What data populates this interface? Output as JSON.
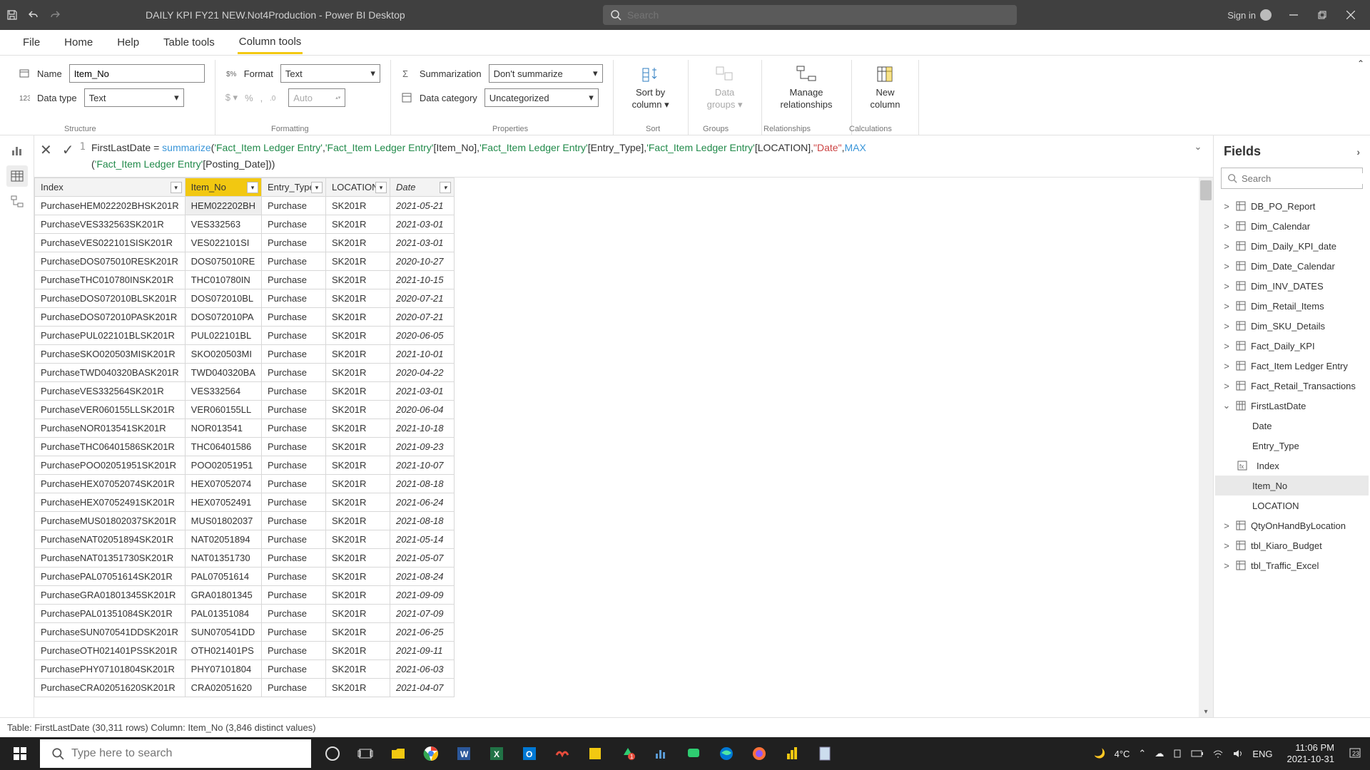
{
  "title": "DAILY KPI FY21 NEW.Not4Production - Power BI Desktop",
  "search_placeholder": "Search",
  "signin": "Sign in",
  "tabs": {
    "file": "File",
    "home": "Home",
    "help": "Help",
    "table_tools": "Table tools",
    "column_tools": "Column tools"
  },
  "ribbon": {
    "name_label": "Name",
    "name_value": "Item_No",
    "datatype_label": "Data type",
    "datatype_value": "Text",
    "format_label": "Format",
    "format_value": "Text",
    "auto_value": "Auto",
    "summarization_label": "Summarization",
    "summarization_value": "Don't summarize",
    "datacategory_label": "Data category",
    "datacategory_value": "Uncategorized",
    "sort_by": "Sort by",
    "column": "column",
    "data": "Data",
    "groups": "groups",
    "manage": "Manage",
    "relationships": "relationships",
    "new": "New",
    "calc_column": "column",
    "group_labels": {
      "structure": "Structure",
      "formatting": "Formatting",
      "properties": "Properties",
      "sort": "Sort",
      "groups_g": "Groups",
      "relationships_g": "Relationships",
      "calculations": "Calculations"
    }
  },
  "formula": {
    "line": "1",
    "tokens": [
      {
        "t": "FirstLastDate = ",
        "c": ""
      },
      {
        "t": "summarize",
        "c": "tok-fn"
      },
      {
        "t": "(",
        "c": ""
      },
      {
        "t": "'Fact_Item Ledger Entry'",
        "c": "tok-tbl"
      },
      {
        "t": ",",
        "c": ""
      },
      {
        "t": "'Fact_Item Ledger Entry'",
        "c": "tok-tbl"
      },
      {
        "t": "[Item_No],",
        "c": ""
      },
      {
        "t": "'Fact_Item Ledger Entry'",
        "c": "tok-tbl"
      },
      {
        "t": "[Entry_Type],",
        "c": ""
      },
      {
        "t": "'Fact_Item Ledger Entry'",
        "c": "tok-tbl"
      },
      {
        "t": "[LOCATION],",
        "c": ""
      },
      {
        "t": "\"Date\"",
        "c": "tok-str"
      },
      {
        "t": ",",
        "c": ""
      },
      {
        "t": "MAX",
        "c": "tok-fn"
      },
      {
        "t": "\n(",
        "c": ""
      },
      {
        "t": "'Fact_Item Ledger Entry'",
        "c": "tok-tbl"
      },
      {
        "t": "[Posting_Date]))",
        "c": ""
      }
    ]
  },
  "columns": [
    "Index",
    "Item_No",
    "Entry_Type",
    "LOCATION",
    "Date"
  ],
  "selected_column": "Item_No",
  "rows": [
    {
      "index": "PurchaseHEM022202BHSK201R",
      "item": "HEM022202BH",
      "entry": "Purchase",
      "loc": "SK201R",
      "date": "2021-05-21"
    },
    {
      "index": "PurchaseVES332563SK201R",
      "item": "VES332563",
      "entry": "Purchase",
      "loc": "SK201R",
      "date": "2021-03-01"
    },
    {
      "index": "PurchaseVES022101SISK201R",
      "item": "VES022101SI",
      "entry": "Purchase",
      "loc": "SK201R",
      "date": "2021-03-01"
    },
    {
      "index": "PurchaseDOS075010RESK201R",
      "item": "DOS075010RE",
      "entry": "Purchase",
      "loc": "SK201R",
      "date": "2020-10-27"
    },
    {
      "index": "PurchaseTHC010780INSK201R",
      "item": "THC010780IN",
      "entry": "Purchase",
      "loc": "SK201R",
      "date": "2021-10-15"
    },
    {
      "index": "PurchaseDOS072010BLSK201R",
      "item": "DOS072010BL",
      "entry": "Purchase",
      "loc": "SK201R",
      "date": "2020-07-21"
    },
    {
      "index": "PurchaseDOS072010PASK201R",
      "item": "DOS072010PA",
      "entry": "Purchase",
      "loc": "SK201R",
      "date": "2020-07-21"
    },
    {
      "index": "PurchasePUL022101BLSK201R",
      "item": "PUL022101BL",
      "entry": "Purchase",
      "loc": "SK201R",
      "date": "2020-06-05"
    },
    {
      "index": "PurchaseSKO020503MISK201R",
      "item": "SKO020503MI",
      "entry": "Purchase",
      "loc": "SK201R",
      "date": "2021-10-01"
    },
    {
      "index": "PurchaseTWD040320BASK201R",
      "item": "TWD040320BA",
      "entry": "Purchase",
      "loc": "SK201R",
      "date": "2020-04-22"
    },
    {
      "index": "PurchaseVES332564SK201R",
      "item": "VES332564",
      "entry": "Purchase",
      "loc": "SK201R",
      "date": "2021-03-01"
    },
    {
      "index": "PurchaseVER060155LLSK201R",
      "item": "VER060155LL",
      "entry": "Purchase",
      "loc": "SK201R",
      "date": "2020-06-04"
    },
    {
      "index": "PurchaseNOR013541SK201R",
      "item": "NOR013541",
      "entry": "Purchase",
      "loc": "SK201R",
      "date": "2021-10-18"
    },
    {
      "index": "PurchaseTHC06401586SK201R",
      "item": "THC06401586",
      "entry": "Purchase",
      "loc": "SK201R",
      "date": "2021-09-23"
    },
    {
      "index": "PurchasePOO02051951SK201R",
      "item": "POO02051951",
      "entry": "Purchase",
      "loc": "SK201R",
      "date": "2021-10-07"
    },
    {
      "index": "PurchaseHEX07052074SK201R",
      "item": "HEX07052074",
      "entry": "Purchase",
      "loc": "SK201R",
      "date": "2021-08-18"
    },
    {
      "index": "PurchaseHEX07052491SK201R",
      "item": "HEX07052491",
      "entry": "Purchase",
      "loc": "SK201R",
      "date": "2021-06-24"
    },
    {
      "index": "PurchaseMUS01802037SK201R",
      "item": "MUS01802037",
      "entry": "Purchase",
      "loc": "SK201R",
      "date": "2021-08-18"
    },
    {
      "index": "PurchaseNAT02051894SK201R",
      "item": "NAT02051894",
      "entry": "Purchase",
      "loc": "SK201R",
      "date": "2021-05-14"
    },
    {
      "index": "PurchaseNAT01351730SK201R",
      "item": "NAT01351730",
      "entry": "Purchase",
      "loc": "SK201R",
      "date": "2021-05-07"
    },
    {
      "index": "PurchasePAL07051614SK201R",
      "item": "PAL07051614",
      "entry": "Purchase",
      "loc": "SK201R",
      "date": "2021-08-24"
    },
    {
      "index": "PurchaseGRA01801345SK201R",
      "item": "GRA01801345",
      "entry": "Purchase",
      "loc": "SK201R",
      "date": "2021-09-09"
    },
    {
      "index": "PurchasePAL01351084SK201R",
      "item": "PAL01351084",
      "entry": "Purchase",
      "loc": "SK201R",
      "date": "2021-07-09"
    },
    {
      "index": "PurchaseSUN070541DDSK201R",
      "item": "SUN070541DD",
      "entry": "Purchase",
      "loc": "SK201R",
      "date": "2021-06-25"
    },
    {
      "index": "PurchaseOTH021401PSSK201R",
      "item": "OTH021401PS",
      "entry": "Purchase",
      "loc": "SK201R",
      "date": "2021-09-11"
    },
    {
      "index": "PurchasePHY07101804SK201R",
      "item": "PHY07101804",
      "entry": "Purchase",
      "loc": "SK201R",
      "date": "2021-06-03"
    },
    {
      "index": "PurchaseCRA02051620SK201R",
      "item": "CRA02051620",
      "entry": "Purchase",
      "loc": "SK201R",
      "date": "2021-04-07"
    }
  ],
  "fields": {
    "header": "Fields",
    "search_placeholder": "Search",
    "tables": [
      {
        "name": "DB_PO_Report",
        "open": false,
        "icon": "table"
      },
      {
        "name": "Dim_Calendar",
        "open": false,
        "icon": "table"
      },
      {
        "name": "Dim_Daily_KPI_date",
        "open": false,
        "icon": "table"
      },
      {
        "name": "Dim_Date_Calendar",
        "open": false,
        "icon": "table"
      },
      {
        "name": "Dim_INV_DATES",
        "open": false,
        "icon": "table"
      },
      {
        "name": "Dim_Retail_Items",
        "open": false,
        "icon": "table"
      },
      {
        "name": "Dim_SKU_Details",
        "open": false,
        "icon": "table"
      },
      {
        "name": "Fact_Daily_KPI",
        "open": false,
        "icon": "table"
      },
      {
        "name": "Fact_Item Ledger Entry",
        "open": false,
        "icon": "table"
      },
      {
        "name": "Fact_Retail_Transactions",
        "open": false,
        "icon": "table"
      },
      {
        "name": "FirstLastDate",
        "open": true,
        "icon": "calc",
        "children": [
          {
            "name": "Date",
            "icon": ""
          },
          {
            "name": "Entry_Type",
            "icon": ""
          },
          {
            "name": "Index",
            "icon": "fx"
          },
          {
            "name": "Item_No",
            "icon": "",
            "selected": true
          },
          {
            "name": "LOCATION",
            "icon": ""
          }
        ]
      },
      {
        "name": "QtyOnHandByLocation",
        "open": false,
        "icon": "table"
      },
      {
        "name": "tbl_Kiaro_Budget",
        "open": false,
        "icon": "table"
      },
      {
        "name": "tbl_Traffic_Excel",
        "open": false,
        "icon": "table"
      }
    ]
  },
  "statusbar": "Table: FirstLastDate (30,311 rows) Column: Item_No (3,846 distinct values)",
  "taskbar": {
    "search_placeholder": "Type here to search",
    "temp": "4°C",
    "lang": "ENG",
    "time": "11:06 PM",
    "date": "2021-10-31"
  }
}
